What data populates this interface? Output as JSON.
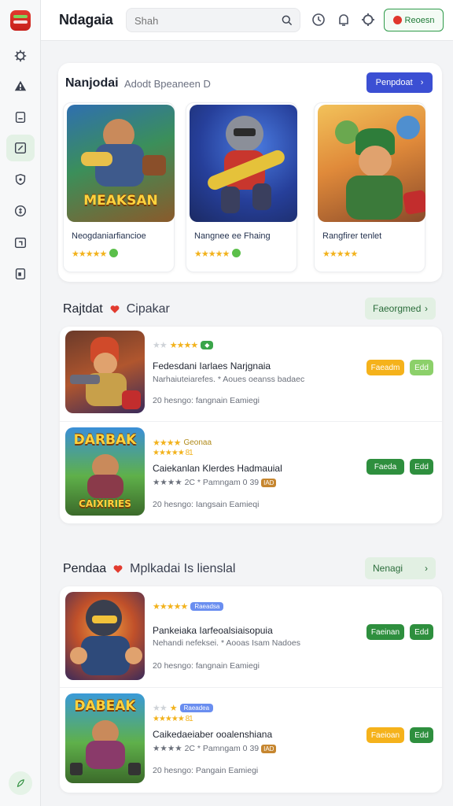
{
  "app": {
    "title": "Ndagaia"
  },
  "search": {
    "placeholder": "Shah"
  },
  "header": {
    "register_label": "Reoesn"
  },
  "featured": {
    "title": "Nanjodai",
    "subtitle": "Adodt Bpeaneen D",
    "button_label": "Penpdoat",
    "cards": [
      {
        "name": "Neogdaniarfiancioe",
        "stars": "★★★★★",
        "art_text": "MEAKSAN"
      },
      {
        "name": "Nangnee ee Fhaing",
        "stars": "★★★★★"
      },
      {
        "name": "Rangfirer tenlet",
        "stars": "★★★★★"
      }
    ]
  },
  "section1": {
    "title": "Rajtdat",
    "subtitle": "Cipakar",
    "button_label": "Faeorgmed",
    "rows": [
      {
        "rating": "★★★★",
        "rating_gray": "★★",
        "chip": "◆",
        "title": "Fedesdani Iarlaes Narjgnaia",
        "desc": "Narhaiuteiarefes. * Aoues oeanss badaec",
        "meta": "20 hesngo: fangnain Eamiegi",
        "btn_a": "Faeadm",
        "btn_b": "Edd"
      },
      {
        "rating": "★★★★",
        "chip": "Geonaa",
        "sub_stars": "★★★★★ 81",
        "title": "Caiekanlan Klerdes Hadmauial",
        "desc": "★★★★ 2C  * Pamngam 0 39",
        "tag": "IAD",
        "meta": "20 hesngo: Iangsain Eamieqi",
        "btn_a": "Faeda",
        "btn_b": "Edd",
        "art_text_top": "DARBAK",
        "art_text_bottom": "CAIXIRIES"
      }
    ]
  },
  "section2": {
    "title": "Pendaa",
    "subtitle": "Mplkadai Is lienslal",
    "button_label": "Nenagi",
    "rows": [
      {
        "rating": "★★★★★",
        "chip": "Raeadsa",
        "title": "Pankeiaka Iarfeoalsiaisopuia",
        "desc": "Nehandi nefeksei. * Aooas Isam Nadoes",
        "meta": "20 hesngo: fangnain Eamiegi",
        "btn_a": "Faeinan",
        "btn_b": "Edd"
      },
      {
        "rating": "★",
        "rating_gray": "★★",
        "chip": "Raeadea",
        "sub_stars": "★★★★★ 81",
        "title": "Caikedaeiaber ooalenshiana",
        "desc": "★★★★ 2C  * Pamngam 0 39",
        "tag": "IAD",
        "meta": "20 hesngo: Pangain Eamiegi",
        "btn_a": "Faeioan",
        "btn_b": "Edd",
        "art_text_top": "DABEAK"
      }
    ]
  }
}
